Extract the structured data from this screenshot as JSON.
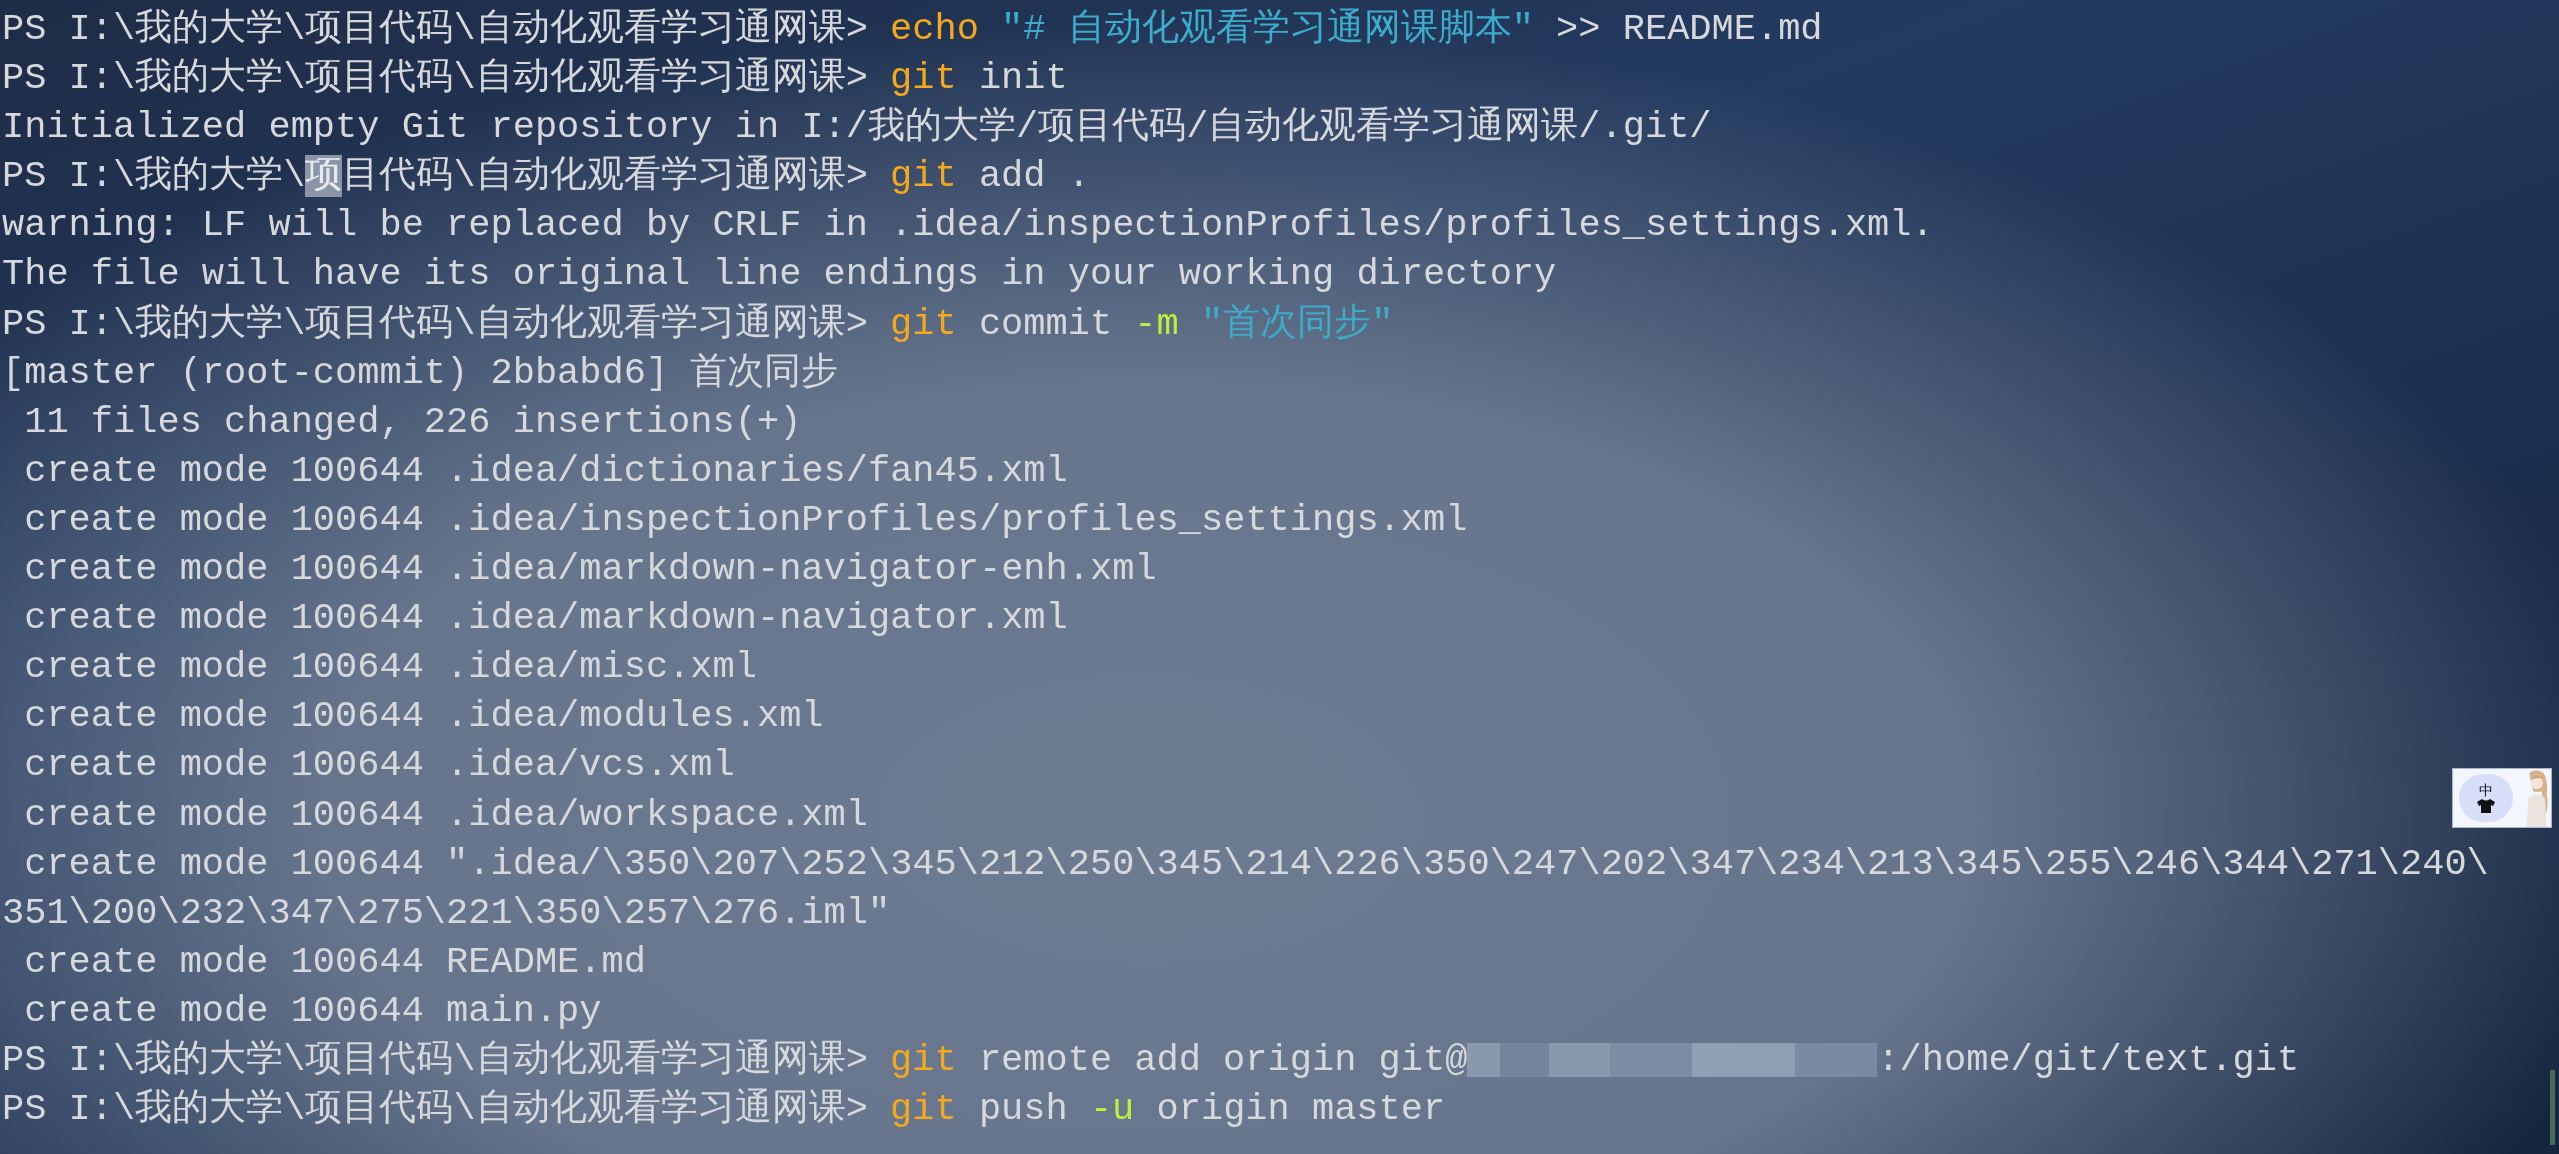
{
  "terminal": {
    "lines": [
      [
        {
          "kind": "prompt",
          "text": "PS I:\\我的大学\\项目代码\\自动化观看学习通网课> "
        },
        {
          "kind": "command",
          "text": "echo"
        },
        {
          "kind": "string",
          "text": " \"# 自动化观看学习通网课脚本\""
        },
        {
          "kind": "plain",
          "text": " >> README.md"
        }
      ],
      [
        {
          "kind": "prompt",
          "text": "PS I:\\我的大学\\项目代码\\自动化观看学习通网课> "
        },
        {
          "kind": "command",
          "text": "git"
        },
        {
          "kind": "plain",
          "text": " init"
        }
      ],
      [
        {
          "kind": "plain",
          "text": "Initialized empty Git repository in I:/我的大学/项目代码/自动化观看学习通网课/.git/"
        }
      ],
      [
        {
          "kind": "prompt",
          "text": "PS I:\\我的大学\\"
        },
        {
          "kind": "selection",
          "text": "项"
        },
        {
          "kind": "prompt",
          "text": "目代码\\自动化观看学习通网课> "
        },
        {
          "kind": "command",
          "text": "git"
        },
        {
          "kind": "plain",
          "text": " add ."
        }
      ],
      [
        {
          "kind": "plain",
          "text": "warning: LF will be replaced by CRLF in .idea/inspectionProfiles/profiles_settings.xml."
        }
      ],
      [
        {
          "kind": "plain",
          "text": "The file will have its original line endings in your working directory"
        }
      ],
      [
        {
          "kind": "prompt",
          "text": "PS I:\\我的大学\\项目代码\\自动化观看学习通网课> "
        },
        {
          "kind": "command",
          "text": "git"
        },
        {
          "kind": "plain",
          "text": " commit "
        },
        {
          "kind": "parameter",
          "text": "-m"
        },
        {
          "kind": "string",
          "text": " \"首次同步\""
        }
      ],
      [
        {
          "kind": "plain",
          "text": "[master (root-commit) 2bbabd6] 首次同步"
        }
      ],
      [
        {
          "kind": "plain",
          "text": " 11 files changed, 226 insertions(+)"
        }
      ],
      [
        {
          "kind": "plain",
          "text": " create mode 100644 .idea/dictionaries/fan45.xml"
        }
      ],
      [
        {
          "kind": "plain",
          "text": " create mode 100644 .idea/inspectionProfiles/profiles_settings.xml"
        }
      ],
      [
        {
          "kind": "plain",
          "text": " create mode 100644 .idea/markdown-navigator-enh.xml"
        }
      ],
      [
        {
          "kind": "plain",
          "text": " create mode 100644 .idea/markdown-navigator.xml"
        }
      ],
      [
        {
          "kind": "plain",
          "text": " create mode 100644 .idea/misc.xml"
        }
      ],
      [
        {
          "kind": "plain",
          "text": " create mode 100644 .idea/modules.xml"
        }
      ],
      [
        {
          "kind": "plain",
          "text": " create mode 100644 .idea/vcs.xml"
        }
      ],
      [
        {
          "kind": "plain",
          "text": " create mode 100644 .idea/workspace.xml"
        }
      ],
      [
        {
          "kind": "plain",
          "text": " create mode 100644 \".idea/\\350\\207\\252\\345\\212\\250\\345\\214\\226\\350\\247\\202\\347\\234\\213\\345\\255\\246\\344\\271\\240\\"
        }
      ],
      [
        {
          "kind": "plain",
          "text": "351\\200\\232\\347\\275\\221\\350\\257\\276.iml\""
        }
      ],
      [
        {
          "kind": "plain",
          "text": " create mode 100644 README.md"
        }
      ],
      [
        {
          "kind": "plain",
          "text": " create mode 100644 main.py"
        }
      ],
      [
        {
          "kind": "prompt",
          "text": "PS I:\\我的大学\\项目代码\\自动化观看学习通网课> "
        },
        {
          "kind": "command",
          "text": "git"
        },
        {
          "kind": "plain",
          "text": " remote add origin git@"
        },
        {
          "kind": "redacted"
        },
        {
          "kind": "plain",
          "text": ":/home/git/text.git"
        }
      ],
      [
        {
          "kind": "prompt",
          "text": "PS I:\\我的大学\\项目代码\\自动化观看学习通网课> "
        },
        {
          "kind": "command",
          "text": "git"
        },
        {
          "kind": "plain",
          "text": " push "
        },
        {
          "kind": "parameter",
          "text": "-u"
        },
        {
          "kind": "plain",
          "text": " origin master"
        }
      ]
    ]
  },
  "ime": {
    "mode": "中"
  }
}
